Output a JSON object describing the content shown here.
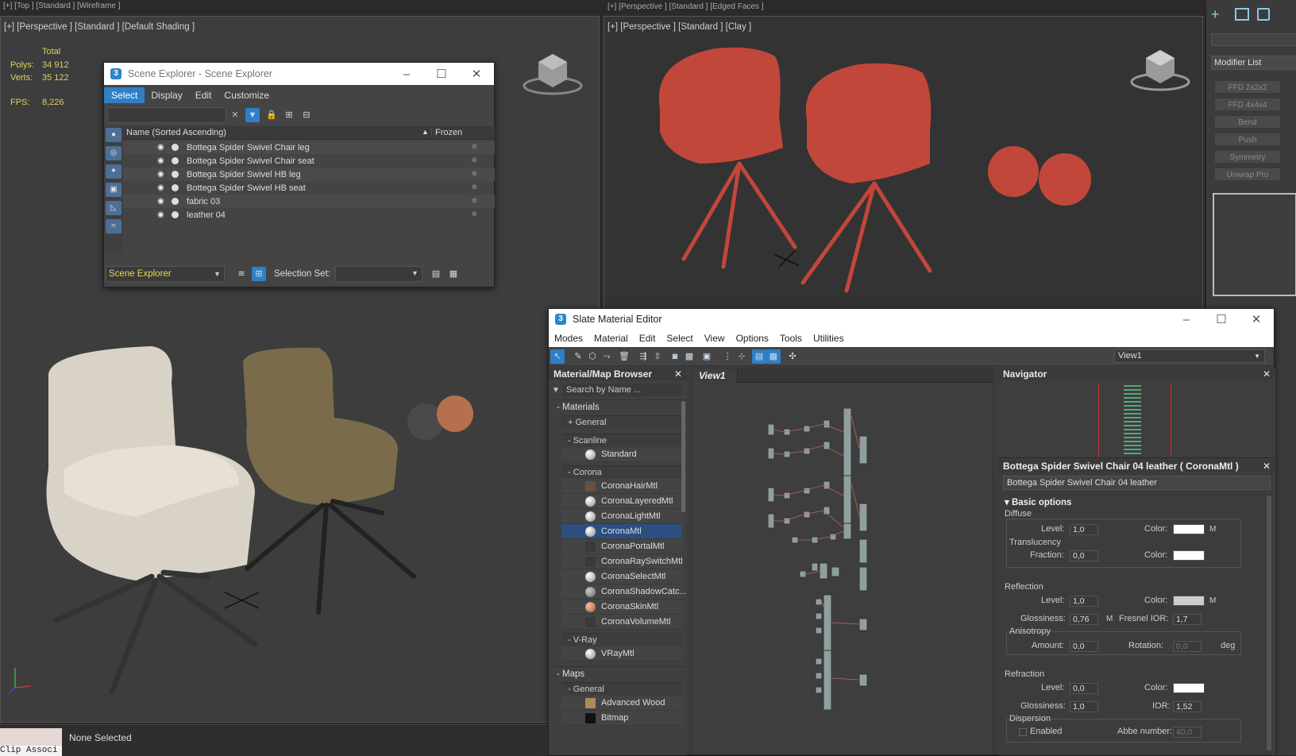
{
  "top_labels": {
    "left": "[+] [Top ] [Standard ] [Wireframe ]",
    "right": "[+] [Perspective ] [Standard ] [Edged Faces ]"
  },
  "viewport_left": {
    "label": "[+] [Perspective ] [Standard ] [Default Shading ]",
    "stats": {
      "total": "Total",
      "polys_k": "Polys:",
      "polys_v": "34 912",
      "verts_k": "Verts:",
      "verts_v": "35 122",
      "fps_k": "FPS:",
      "fps_v": "8,226"
    }
  },
  "viewport_right": {
    "label": "[+] [Perspective ] [Standard ] [Clay ]"
  },
  "scene_explorer": {
    "title": "Scene Explorer - Scene Explorer",
    "menu": [
      "Select",
      "Display",
      "Edit",
      "Customize"
    ],
    "col_name": "Name (Sorted Ascending)",
    "col_sort": "▲",
    "col_frozen": "Frozen",
    "rows": [
      "Bottega Spider Swivel Chair leg",
      "Bottega Spider Swivel Chair seat",
      "Bottega Spider Swivel HB leg",
      "Bottega Spider Swivel HB seat",
      "fabric 03",
      "leather 04"
    ],
    "footer_combo": "Scene Explorer",
    "footer_sel_label": "Selection Set:"
  },
  "command_panel": {
    "modifier_list": "Modifier List",
    "buttons": [
      "FFD 2x2x2",
      "FFD 4x4x4",
      "Bend",
      "Push",
      "Symmetry",
      "Unwrap Pro"
    ]
  },
  "slate": {
    "title": "Slate Material Editor",
    "menu": [
      "Modes",
      "Material",
      "Edit",
      "Select",
      "View",
      "Options",
      "Tools",
      "Utilities"
    ],
    "view_combo": "View1",
    "browser_title": "Material/Map Browser",
    "search_placeholder": "Search by Name ...",
    "materials": "- Materials",
    "general": "+ General",
    "scanline": "- Scanline",
    "scanline_items": [
      "Standard"
    ],
    "corona": "- Corona",
    "corona_items": [
      "CoronaHairMtl",
      "CoronaLayeredMtl",
      "CoronaLightMtl",
      "CoronaMtl",
      "CoronaPortalMtl",
      "CoronaRaySwitchMtl",
      "CoronaSelectMtl",
      "CoronaShadowCatc...",
      "CoronaSkinMtl",
      "CoronaVolumeMtl"
    ],
    "vray": "- V-Ray",
    "vray_items": [
      "VRayMtl"
    ],
    "maps": "- Maps",
    "maps_general": "- General",
    "maps_items": [
      "Advanced Wood",
      "Bitmap"
    ],
    "view_tab": "View1",
    "navigator": "Navigator",
    "param_title": "Bottega Spider Swivel Chair 04 leather  ( CoronaMtl )",
    "param_name": "Bottega Spider Swivel Chair 04 leather",
    "basic_options": "Basic options",
    "diffuse": "Diffuse",
    "level": "Level:",
    "level_v": "1,0",
    "color": "Color:",
    "m": "M",
    "translucency": "Translucency",
    "fraction": "Fraction:",
    "fraction_v": "0,0",
    "reflection": "Reflection",
    "refl_level_v": "1,0",
    "glossiness": "Glossiness:",
    "refl_gloss_v": "0,76",
    "fresnel": "Fresnel IOR:",
    "fresnel_v": "1,7",
    "anisotropy": "Anisotropy",
    "amount": "Amount:",
    "amount_v": "0,0",
    "rotation": "Rotation:",
    "rotation_v": "0,0",
    "deg": "deg",
    "refraction": "Refraction",
    "refr_level_v": "0,0",
    "refr_gloss_v": "1,0",
    "ior": "IOR:",
    "ior_v": "1,52",
    "dispersion": "Dispersion",
    "enabled": "Enabled",
    "abbe": "Abbe number:",
    "abbe_v": "40,0"
  },
  "status": {
    "none_selected": "None Selected",
    "clip": "Clip Associ"
  },
  "colors": {
    "accent": "#2f7fc7",
    "stat_yellow": "#e0d060",
    "chair_red": "#c2473b"
  }
}
